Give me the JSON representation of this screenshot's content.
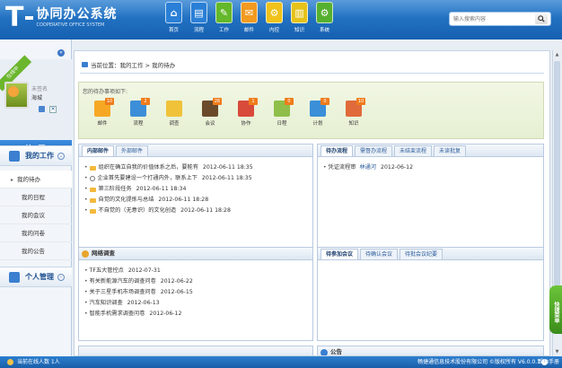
{
  "header": {
    "logo_letter": "T",
    "logo_title": "协同办公系统",
    "logo_subtitle": "COOPERATIVE OFFICE SYSTEM",
    "nav": [
      {
        "label": "首页",
        "icon": "home-icon",
        "color": "#2a7fd6",
        "glyph": "⌂"
      },
      {
        "label": "流程",
        "icon": "flow-icon",
        "color": "#2a7fd6",
        "glyph": "▤"
      },
      {
        "label": "工作",
        "icon": "work-icon",
        "color": "#64b82a",
        "glyph": "✎"
      },
      {
        "label": "邮件",
        "icon": "mail-icon",
        "color": "#f39a20",
        "glyph": "✉"
      },
      {
        "label": "内控",
        "icon": "control-icon",
        "color": "#f0c21a",
        "glyph": "⚙"
      },
      {
        "label": "知识",
        "icon": "knowledge-icon",
        "color": "#e6c21a",
        "glyph": "▥"
      },
      {
        "label": "系统",
        "icon": "system-icon",
        "color": "#56b030",
        "glyph": "⚙"
      }
    ],
    "search_placeholder": "输入搜索内容"
  },
  "sidebar": {
    "online_ribbon": "在线中",
    "signature": "未签名",
    "username": "海城",
    "home_label": "首 页",
    "sections": [
      {
        "label": "我的工作",
        "icon_color": "#3a7fd0"
      },
      {
        "label": "个人管理",
        "icon_color": "#3a7fd0"
      }
    ],
    "submenu": [
      "我的待办",
      "我的日程",
      "我的会议",
      "我的问卷",
      "我的公告"
    ]
  },
  "main": {
    "breadcrumb": "当前位置：我的工作 > 我的待办",
    "todo_title": "您的待办事项如下:",
    "todo_items": [
      {
        "label": "邮件",
        "count": "10",
        "color": "#f6a825"
      },
      {
        "label": "流程",
        "count": "2",
        "color": "#3d8ed8"
      },
      {
        "label": "调查",
        "count": "",
        "color": "#f0c23a"
      },
      {
        "label": "会议",
        "count": "26",
        "color": "#6a4a2a"
      },
      {
        "label": "协作",
        "count": "1",
        "color": "#d84a3a"
      },
      {
        "label": "日程",
        "count": "0",
        "color": "#8fbf4a"
      },
      {
        "label": "计划",
        "count": "0",
        "color": "#3a8fd8"
      },
      {
        "label": "知识",
        "count": "10",
        "color": "#e06a3a"
      }
    ],
    "mail_panel": {
      "tabs": [
        "内部邮件",
        "外部邮件"
      ],
      "items": [
        {
          "title": "组织在确立自我的价值体系之后，要能有",
          "date": "2012-06-11 18:35",
          "icon": "folder-icon"
        },
        {
          "title": "企业首先要建设一个打通内外，联系上下",
          "date": "2012-06-11 18:35",
          "icon": "clip-icon"
        },
        {
          "title": "第三阶段任务",
          "date": "2012-06-11 18:34",
          "icon": "folder-icon"
        },
        {
          "title": "自觉的文化提炼与总结",
          "date": "2012-06-11 18:28",
          "icon": "folder-icon"
        },
        {
          "title": "不自觉的（无意识）的文化创造",
          "date": "2012-06-11 18:28",
          "icon": "folder-icon"
        }
      ]
    },
    "flow_panel": {
      "tabs": [
        "待办流程",
        "需督办流程",
        "未结束流程",
        "未读批复"
      ],
      "items": [
        {
          "title": "凭证流程审",
          "sender": "林通河",
          "date": "2012-06-12"
        }
      ]
    },
    "survey_panel": {
      "title": "网络调查",
      "items": [
        {
          "title": "TF五大管控点",
          "date": "2012-07-31"
        },
        {
          "title": "有关新能源汽车的调查问卷",
          "date": "2012-06-22"
        },
        {
          "title": "关于三星手机市场调查问卷",
          "date": "2012-06-15"
        },
        {
          "title": "汽车知识调查",
          "date": "2012-06-13"
        },
        {
          "title": "智能手机需求调查问卷",
          "date": "2012-06-12"
        }
      ]
    },
    "meeting_panel": {
      "tabs": [
        "待参加会议",
        "待确认会议",
        "待批会议纪要"
      ]
    },
    "bottom_partial_title": "公告"
  },
  "right_tab": "快捷菜单",
  "statusbar": {
    "online": "当前在线人数 1人",
    "company": "畅捷通信息技术股份有限公司 ©版权所有 V6.0.0.1",
    "help": "帮助手册"
  }
}
